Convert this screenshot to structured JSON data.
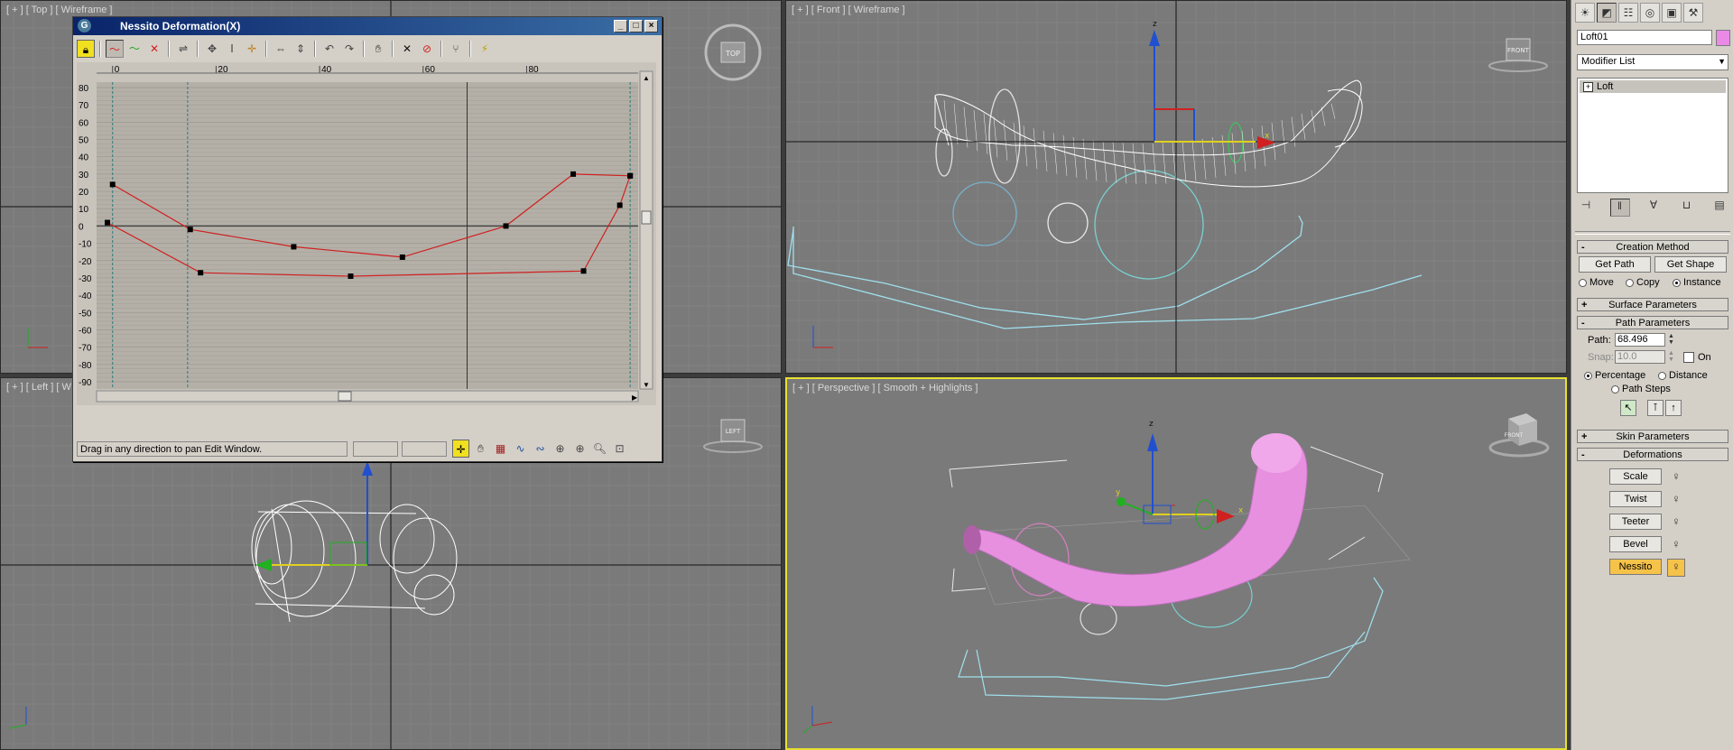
{
  "viewports": {
    "top": {
      "label": "[ + ] [ Top ] [ Wireframe ]",
      "cube": "TOP"
    },
    "front": {
      "label": "[ + ] [ Front ] [ Wireframe ]",
      "cube": "FRONT"
    },
    "left": {
      "label": "[ + ] [ Left ] [ W",
      "cube": "LEFT"
    },
    "perspective": {
      "label": "[ + ] [ Perspective ] [ Smooth + Highlights ]",
      "cube": "FRONT"
    }
  },
  "axis_labels": {
    "x": "x",
    "y": "y",
    "z": "z"
  },
  "dialog": {
    "title": "Nessito Deformation(X)",
    "status": "Drag in any direction to pan Edit Window.",
    "min": "_",
    "max": "□",
    "close": "×"
  },
  "graph": {
    "x_ticks": [
      "0",
      "20",
      "40",
      "60",
      "80"
    ],
    "y_ticks": [
      "80",
      "70",
      "60",
      "50",
      "40",
      "30",
      "20",
      "10",
      "0",
      "-10",
      "-20",
      "-30",
      "-40",
      "-50",
      "-60",
      "-70",
      "-80",
      "-90"
    ],
    "upper_curve": [
      [
        0,
        24
      ],
      [
        15,
        -2
      ],
      [
        35,
        -12
      ],
      [
        56,
        -18
      ],
      [
        76,
        0
      ],
      [
        89,
        30
      ],
      [
        100,
        29
      ]
    ],
    "lower_curve": [
      [
        -1,
        2
      ],
      [
        17,
        -27
      ],
      [
        46,
        -29
      ],
      [
        91,
        -26
      ],
      [
        98,
        12
      ],
      [
        100,
        29
      ]
    ]
  },
  "command_panel": {
    "tabs": [
      "create-icon",
      "modify-icon",
      "hierarchy-icon",
      "motion-icon",
      "display-icon",
      "utilities-icon"
    ],
    "object_name": "Loft01",
    "object_color": "#ea8ae6",
    "modifier_list": "Modifier List",
    "stack_item": "Loft",
    "creation_method": {
      "header": "Creation Method",
      "get_path": "Get Path",
      "get_shape": "Get Shape",
      "move": "Move",
      "copy": "Copy",
      "instance": "Instance",
      "selected": "instance"
    },
    "surface_parameters": "Surface Parameters",
    "path_parameters": {
      "header": "Path Parameters",
      "path_label": "Path:",
      "path_value": "68.496",
      "snap_label": "Snap:",
      "snap_value": "10.0",
      "on_label": "On",
      "percentage": "Percentage",
      "distance": "Distance",
      "path_steps": "Path Steps",
      "selected": "percentage"
    },
    "skin_parameters": "Skin Parameters",
    "deformations": {
      "header": "Deformations",
      "scale": "Scale",
      "twist": "Twist",
      "teeter": "Teeter",
      "bevel": "Bevel",
      "nessito": "Nessito"
    }
  }
}
